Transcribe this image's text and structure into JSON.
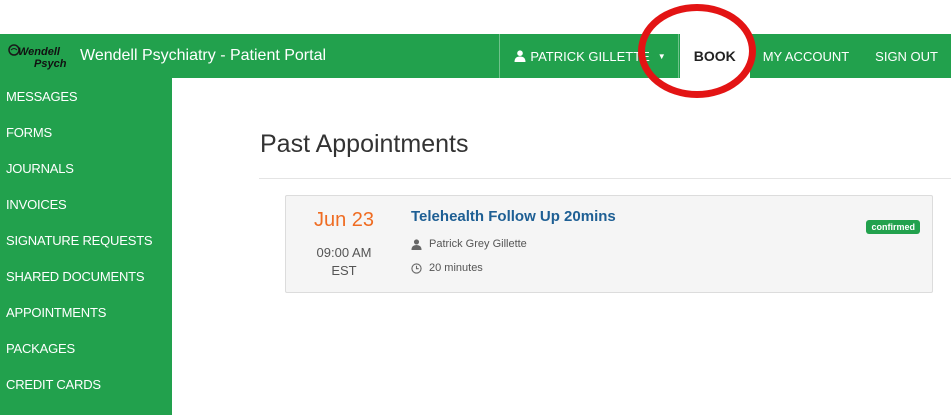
{
  "header": {
    "logo_text": "Wendell Psych",
    "title": "Wendell Psychiatry - Patient Portal",
    "user_name": "PATRICK GILLETTE",
    "book_label": "BOOK",
    "my_account_label": "MY ACCOUNT",
    "sign_out_label": "SIGN OUT"
  },
  "sidebar": {
    "items": [
      {
        "label": "MESSAGES"
      },
      {
        "label": "FORMS"
      },
      {
        "label": "JOURNALS"
      },
      {
        "label": "INVOICES"
      },
      {
        "label": "SIGNATURE REQUESTS"
      },
      {
        "label": "SHARED DOCUMENTS"
      },
      {
        "label": "APPOINTMENTS"
      },
      {
        "label": "PACKAGES"
      },
      {
        "label": "CREDIT CARDS"
      }
    ]
  },
  "main": {
    "title": "Past Appointments",
    "appointments": [
      {
        "date": "Jun 23",
        "time": "09:00 AM",
        "timezone": "EST",
        "name": "Telehealth Follow Up 20mins",
        "provider": "Patrick Grey Gillette",
        "duration": "20 minutes",
        "status": "confirmed"
      }
    ]
  },
  "colors": {
    "brand_green": "#22a14d",
    "date_orange": "#ef6c22",
    "link_blue": "#1e5f94",
    "annotation_red": "#e31414"
  },
  "icons": {
    "user": "user-icon",
    "caret": "chevron-down-icon",
    "clock": "clock-icon"
  }
}
